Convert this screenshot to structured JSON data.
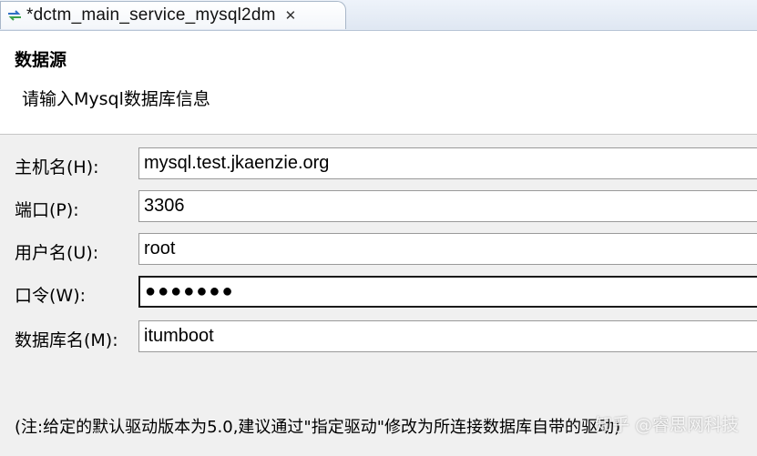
{
  "tab": {
    "title": "*dctm_main_service_mysql2dm",
    "close_glyph": "✕",
    "icon": "sync-arrows-icon"
  },
  "header": {
    "title": "数据源",
    "description": "请输入Mysql数据库信息"
  },
  "form": {
    "host": {
      "label": "主机名(H):",
      "value": "mysql.test.jkaenzie.org"
    },
    "port": {
      "label": "端口(P):",
      "value": "3306"
    },
    "user": {
      "label": "用户名(U):",
      "value": "root"
    },
    "password": {
      "label": "口令(W):",
      "value": "●●●●●●●"
    },
    "database": {
      "label": "数据库名(M):",
      "value": "itumboot"
    }
  },
  "note": "(注:给定的默认驱动版本为5.0,建议通过\"指定驱动\"修改为所连接数据库自带的驱动)",
  "watermark": "知乎 @睿思网科技",
  "colors": {
    "tab_accent": "#3a7bd5",
    "background": "#f0f0f0",
    "header_background": "#ffffff"
  }
}
